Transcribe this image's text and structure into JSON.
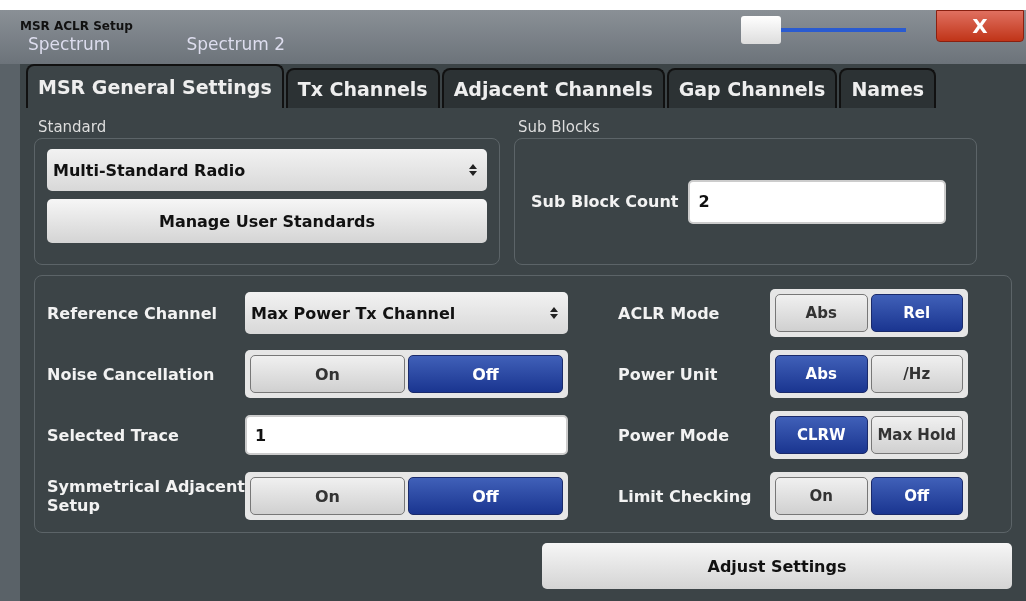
{
  "window": {
    "title": "MSR ACLR Setup",
    "background_tabs": [
      {
        "label": "Spectrum"
      },
      {
        "label": "Spectrum 2"
      }
    ],
    "transparency_slider": {
      "level": 0
    },
    "close_button": "X"
  },
  "tabs": [
    {
      "label": "MSR General Settings",
      "selected": true
    },
    {
      "label": "Tx Channels",
      "selected": false
    },
    {
      "label": "Adjacent Channels",
      "selected": false
    },
    {
      "label": "Gap Channels",
      "selected": false
    },
    {
      "label": "Names",
      "selected": false
    }
  ],
  "standard": {
    "heading": "Standard",
    "value": "Multi-Standard Radio",
    "button": "Manage User Standards"
  },
  "sub_blocks": {
    "heading": "Sub Blocks",
    "label": "Sub Block Count",
    "value": "2"
  },
  "left_settings": [
    {
      "kind": "dropdown",
      "label": "Reference Channel",
      "value": "Max Power Tx Channel"
    },
    {
      "kind": "toggle",
      "label": "Noise Cancellation",
      "options": [
        {
          "label": "On",
          "selected": false
        },
        {
          "label": "Off",
          "selected": true
        }
      ]
    },
    {
      "kind": "field",
      "label": "Selected Trace",
      "value": "1"
    },
    {
      "kind": "toggle",
      "label": "Symmetrical Adjacent Setup",
      "options": [
        {
          "label": "On",
          "selected": false
        },
        {
          "label": "Off",
          "selected": true
        }
      ]
    }
  ],
  "right_settings": [
    {
      "kind": "toggle",
      "label": "ACLR Mode",
      "options": [
        {
          "label": "Abs",
          "selected": false
        },
        {
          "label": "Rel",
          "selected": true
        }
      ]
    },
    {
      "kind": "toggle",
      "label": "Power Unit",
      "options": [
        {
          "label": "Abs",
          "selected": true
        },
        {
          "label": "/Hz",
          "selected": false
        }
      ]
    },
    {
      "kind": "toggle",
      "label": "Power Mode",
      "options": [
        {
          "label": "CLRW",
          "selected": true
        },
        {
          "label": "Max Hold",
          "selected": false
        }
      ]
    },
    {
      "kind": "toggle",
      "label": "Limit Checking",
      "options": [
        {
          "label": "On",
          "selected": false
        },
        {
          "label": "Off",
          "selected": true
        }
      ]
    }
  ],
  "adjust_button": "Adjust Settings"
}
